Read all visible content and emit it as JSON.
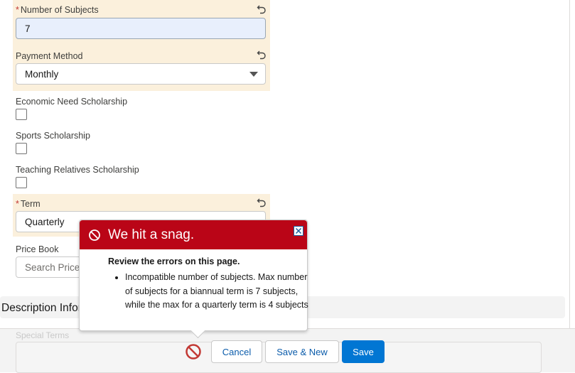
{
  "form": {
    "number_of_subjects": {
      "required_marker": "*",
      "label": "Number of Subjects",
      "value": "7"
    },
    "payment_method": {
      "label": "Payment Method",
      "value": "Monthly"
    },
    "economic_need_scholarship": {
      "label": "Economic Need Scholarship",
      "checked": false
    },
    "sports_scholarship": {
      "label": "Sports Scholarship",
      "checked": false
    },
    "teaching_relatives_scholarship": {
      "label": "Teaching Relatives Scholarship",
      "checked": false
    },
    "term": {
      "required_marker": "*",
      "label": "Term",
      "value": "Quarterly"
    },
    "price_book": {
      "label": "Price Book",
      "placeholder": "Search Price Books..."
    }
  },
  "section": {
    "title": "Description Information"
  },
  "special_terms": {
    "label": "Special Terms"
  },
  "error_popover": {
    "title": "We hit a snag.",
    "body_title": "Review the errors on this page.",
    "errors": [
      "Incompatible number of subjects. Max number of subjects for a biannual term is 7 subjects, while the max for a quarterly term is 4 subjects"
    ]
  },
  "footer": {
    "cancel_label": "Cancel",
    "save_new_label": "Save & New",
    "save_label": "Save"
  },
  "colors": {
    "edited_field_bg": "#fbf0dc",
    "error_header": "#ba0517",
    "brand_button": "#0176d3"
  }
}
